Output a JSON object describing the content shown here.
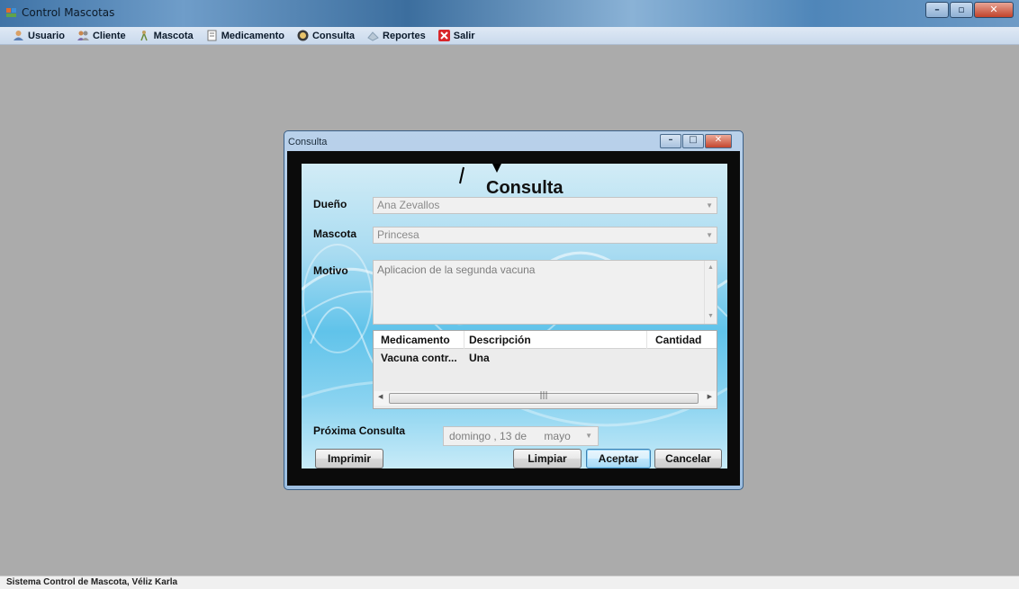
{
  "window": {
    "title": "Control Mascotas"
  },
  "menu": {
    "items": [
      {
        "label": "Usuario",
        "icon": "user-icon"
      },
      {
        "label": "Cliente",
        "icon": "clients-icon"
      },
      {
        "label": "Mascota",
        "icon": "pet-icon"
      },
      {
        "label": "Medicamento",
        "icon": "medicine-icon"
      },
      {
        "label": "Consulta",
        "icon": "consultation-icon"
      },
      {
        "label": "Reportes",
        "icon": "reports-icon"
      },
      {
        "label": "Salir",
        "icon": "exit-icon"
      }
    ]
  },
  "dialog": {
    "title": "Consulta",
    "heading": "Consulta",
    "owner_label": "Dueño",
    "owner_value": "Ana Zevallos",
    "pet_label": "Mascota",
    "pet_value": "Princesa",
    "reason_label": "Motivo",
    "reason_value": "Aplicacion de la segunda vacuna",
    "grid": {
      "columns": [
        "Medicamento",
        "Descripción",
        "Cantidad"
      ],
      "rows": [
        [
          "Vacuna contr...",
          "Una",
          ""
        ]
      ]
    },
    "next_label": "Próxima Consulta",
    "next_date": {
      "weekday": "domingo , 13 de",
      "month": "mayo"
    },
    "buttons": {
      "print": "Imprimir",
      "clear": "Limpiar",
      "accept": "Aceptar",
      "cancel": "Cancelar"
    }
  },
  "status": {
    "text": "Sistema Control de Mascota, Véliz Karla"
  },
  "colors": {
    "accent": "#60c3ea",
    "desktop": "#ababab",
    "dialog_frame": "#0b0b0b"
  }
}
